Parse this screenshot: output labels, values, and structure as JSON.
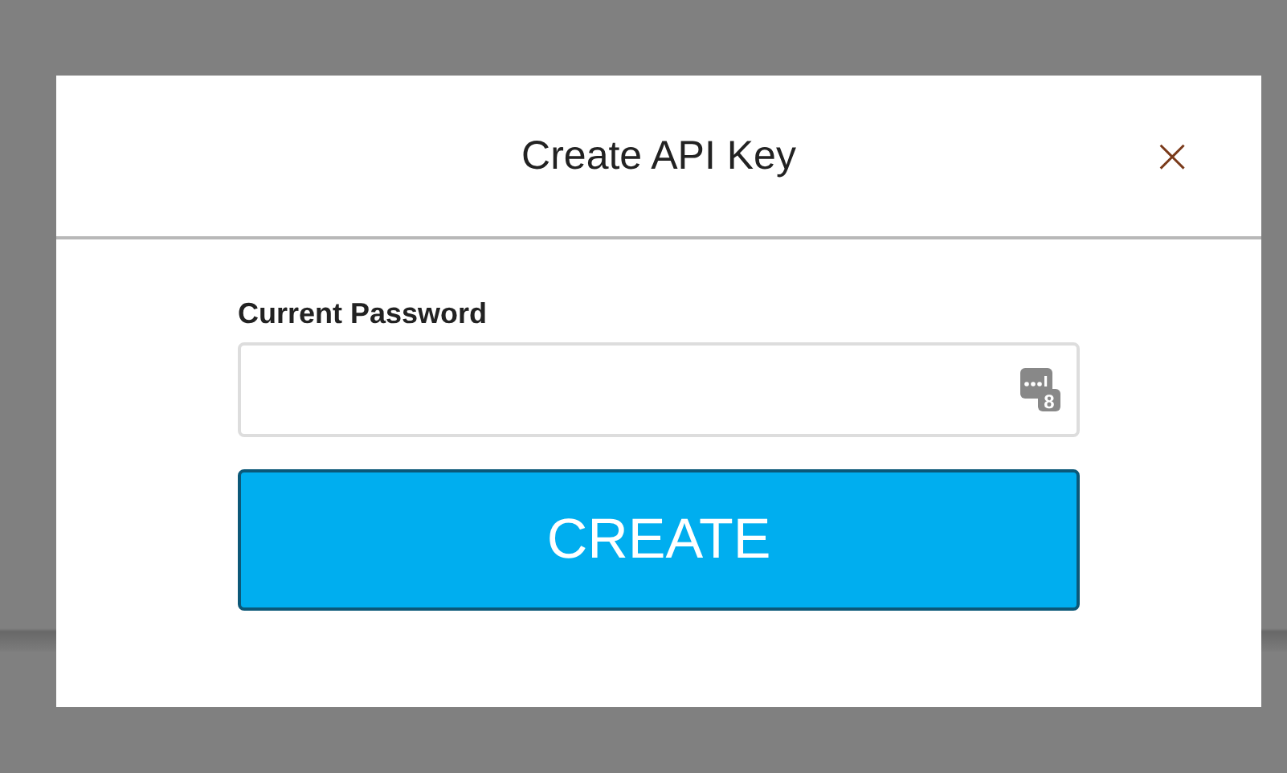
{
  "dialog": {
    "title": "Create API Key",
    "close_label": "×"
  },
  "password_field": {
    "label": "Current Password",
    "icon_badge": "8"
  },
  "buttons": [
    {
      "label": "CREATE"
    }
  ]
}
